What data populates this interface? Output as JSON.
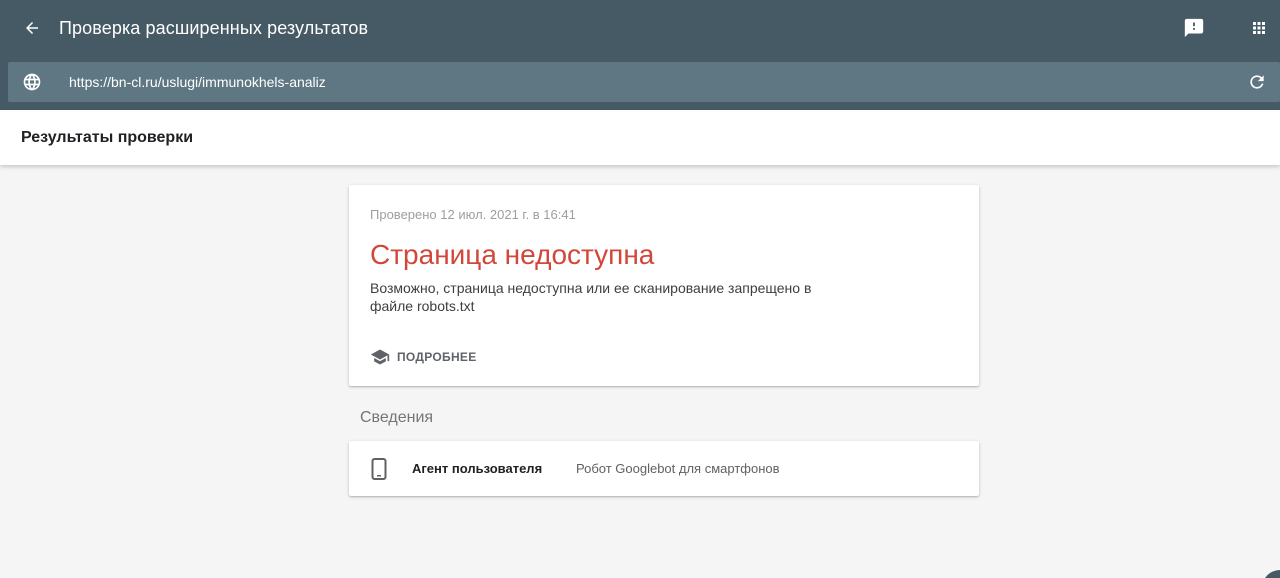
{
  "appbar": {
    "title": "Проверка расширенных результатов",
    "back_icon": "arrow-back-icon",
    "feedback_icon": "feedback-icon",
    "apps_icon": "apps-grid-icon",
    "background": "#455a64"
  },
  "urlbar": {
    "url": "https://bn-cl.ru/uslugi/immunokhels-analiz",
    "globe_icon": "globe-icon",
    "refresh_icon": "refresh-icon"
  },
  "results": {
    "title": "Результаты проверки"
  },
  "status_card": {
    "checked_at": "Проверено 12 июл. 2021 г. в 16:41",
    "heading": "Страница недоступна",
    "description": "Возможно, страница недоступна или ее сканирование запрещено в файле robots.txt",
    "learn_more_icon": "school-icon",
    "learn_more_label": "ПОДРОБНЕЕ",
    "heading_color": "#d2473a"
  },
  "details": {
    "section_label": "Сведения",
    "rows": [
      {
        "icon": "smartphone-icon",
        "key": "Агент пользователя",
        "value": "Робот Googlebot для смартфонов"
      }
    ]
  }
}
